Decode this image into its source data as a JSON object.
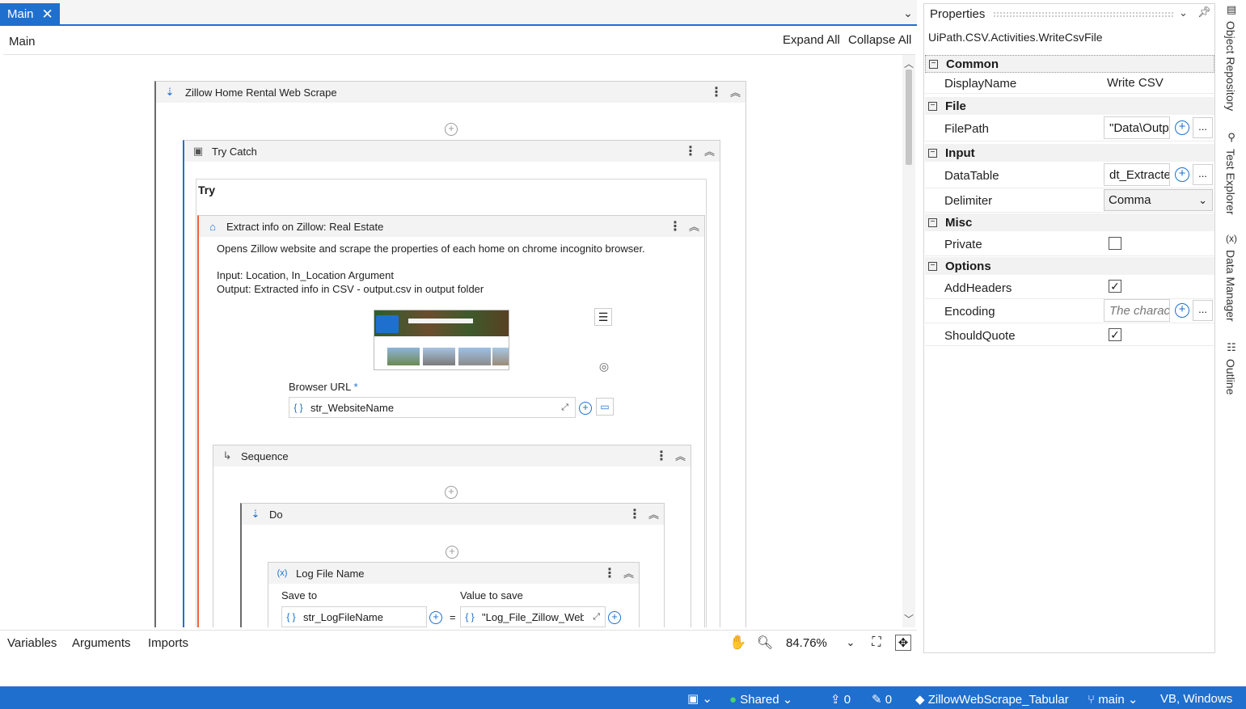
{
  "tabs": {
    "main_label": "Main"
  },
  "designer": {
    "breadcrumb": "Main",
    "expand_all": "Expand All",
    "collapse_all": "Collapse All"
  },
  "workflow": {
    "root_title": "Zillow Home Rental Web Scrape",
    "try_catch_title": "Try Catch",
    "try_label": "Try",
    "extract_title": "Extract info on Zillow: Real Estate",
    "extract_desc": "Opens Zillow website and scrape the properties of each home on chrome incognito browser.",
    "extract_input": "Input: Location, In_Location Argument",
    "extract_output": "Output: Extracted info in CSV - output.csv in output folder",
    "browser_url_label": "Browser URL",
    "browser_url_required": "*",
    "browser_url_value": "str_WebsiteName",
    "sequence_title": "Sequence",
    "do_title": "Do",
    "log_title": "Log File Name",
    "save_to_label": "Save to",
    "value_to_save_label": "Value to save",
    "save_to_value": "str_LogFileName",
    "equals": "=",
    "value_to_save_value": "\"Log_File_Zillow_Web_"
  },
  "bottom_bar": {
    "variables": "Variables",
    "arguments": "Arguments",
    "imports": "Imports",
    "zoom": "84.76%"
  },
  "properties": {
    "title": "Properties",
    "activity_type": "UiPath.CSV.Activities.WriteCsvFile",
    "categories": {
      "common": "Common",
      "file": "File",
      "input": "Input",
      "misc": "Misc",
      "options": "Options"
    },
    "display_name_label": "DisplayName",
    "display_name_value": "Write CSV",
    "file_path_label": "FilePath",
    "file_path_value": "\"Data\\Outp",
    "data_table_label": "DataTable",
    "data_table_value": "dt_Extracte",
    "delimiter_label": "Delimiter",
    "delimiter_value": "Comma",
    "private_label": "Private",
    "private_checked": false,
    "add_headers_label": "AddHeaders",
    "add_headers_checked": true,
    "encoding_label": "Encoding",
    "encoding_placeholder": "The charac",
    "should_quote_label": "ShouldQuote",
    "should_quote_checked": true,
    "ellipsis": "..."
  },
  "side_rail": {
    "object_repository": "Object Repository",
    "test_explorer": "Test Explorer",
    "data_manager": "Data Manager",
    "outline": "Outline"
  },
  "status_bar": {
    "shared": "Shared",
    "push_count": "0",
    "edit_count": "0",
    "project": "ZillowWebScrape_Tabular",
    "branch": "main",
    "language": "VB, Windows"
  },
  "colors": {
    "accent": "#1f6fce",
    "try_border": "#e8633a",
    "status_bar": "#1f6fce"
  }
}
